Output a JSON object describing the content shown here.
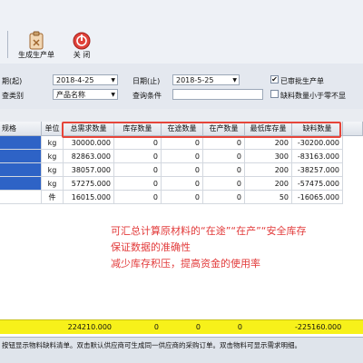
{
  "toolbar": {
    "generate_label": "生成生产单",
    "close_label": "关 闭"
  },
  "filters": {
    "date_start_label": "期(起)",
    "date_start_value": "2018-4-25",
    "date_end_label": "日期(止)",
    "date_end_value": "2018-5-25",
    "category_label": "查类别",
    "category_value": "产品名称",
    "query_label": "查询条件",
    "query_value": "",
    "approved_label": "已审批生产单",
    "approved_checked": "✔",
    "shortage_label": "缺料数量小于零不显"
  },
  "grid": {
    "columns": [
      "规格",
      "单位",
      "总需求数量",
      "库存数量",
      "在途数量",
      "在产数量",
      "最低库存量",
      "缺料数量"
    ],
    "rows": [
      {
        "spec": "",
        "unit": "kg",
        "total": "30000.000",
        "stock": "0",
        "transit": "0",
        "production": "0",
        "min": "200",
        "shortage": "-30200.000"
      },
      {
        "spec": "",
        "unit": "kg",
        "total": "82863.000",
        "stock": "0",
        "transit": "0",
        "production": "0",
        "min": "300",
        "shortage": "-83163.000"
      },
      {
        "spec": "",
        "unit": "kg",
        "total": "38057.000",
        "stock": "0",
        "transit": "0",
        "production": "0",
        "min": "200",
        "shortage": "-38257.000"
      },
      {
        "spec": "",
        "unit": "kg",
        "total": "57275.000",
        "stock": "0",
        "transit": "0",
        "production": "0",
        "min": "200",
        "shortage": "-57475.000"
      },
      {
        "spec": "",
        "unit": "件",
        "total": "16015.000",
        "stock": "0",
        "transit": "0",
        "production": "0",
        "min": "50",
        "shortage": "-16065.000"
      }
    ],
    "totals": {
      "total": "224210.000",
      "stock": "0",
      "transit": "0",
      "production": "0",
      "min": "",
      "shortage": "-225160.000"
    }
  },
  "annotation": {
    "line1": "可汇总计算原材料的“在途”“在产”“安全库存",
    "line2": "保证数据的准确性",
    "line3": "减少库存积压，提高资金的使用率"
  },
  "status": {
    "text": "按钮显示物料缺料清单。双击默认供应商可生成同一供应商的采购订单。双击物料可显示需求明细。"
  },
  "colors": {
    "annotation": "#e23a3a",
    "totals_bg": "#f7f11a",
    "selection": "#2e63c6"
  }
}
